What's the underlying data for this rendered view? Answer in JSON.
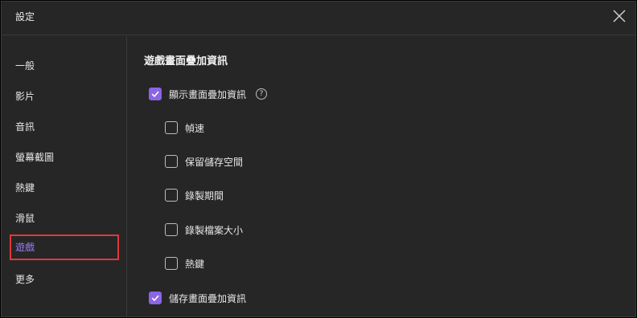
{
  "window": {
    "title": "設定"
  },
  "sidebar": {
    "items": [
      {
        "label": "一般"
      },
      {
        "label": "影片"
      },
      {
        "label": "音訊"
      },
      {
        "label": "螢幕截圖"
      },
      {
        "label": "熱鍵"
      },
      {
        "label": "滑鼠"
      },
      {
        "label": "遊戲"
      },
      {
        "label": "更多"
      }
    ],
    "active_index": 6
  },
  "content": {
    "section_title": "遊戲畫面疊加資訊",
    "show_overlay": {
      "label": "顯示畫面疊加資訊",
      "checked": true,
      "help_icon": "?"
    },
    "sub_options": [
      {
        "label": "幀速",
        "checked": false
      },
      {
        "label": "保留儲存空間",
        "checked": false
      },
      {
        "label": "錄製期間",
        "checked": false
      },
      {
        "label": "錄製檔案大小",
        "checked": false
      },
      {
        "label": "熱鍵",
        "checked": false
      }
    ],
    "save_overlay": {
      "label": "儲存畫面疊加資訊",
      "checked": true
    }
  },
  "colors": {
    "accent": "#8b65e6",
    "active_text": "#9b7df2",
    "highlight_border": "#e0393b",
    "background": "#262626"
  }
}
